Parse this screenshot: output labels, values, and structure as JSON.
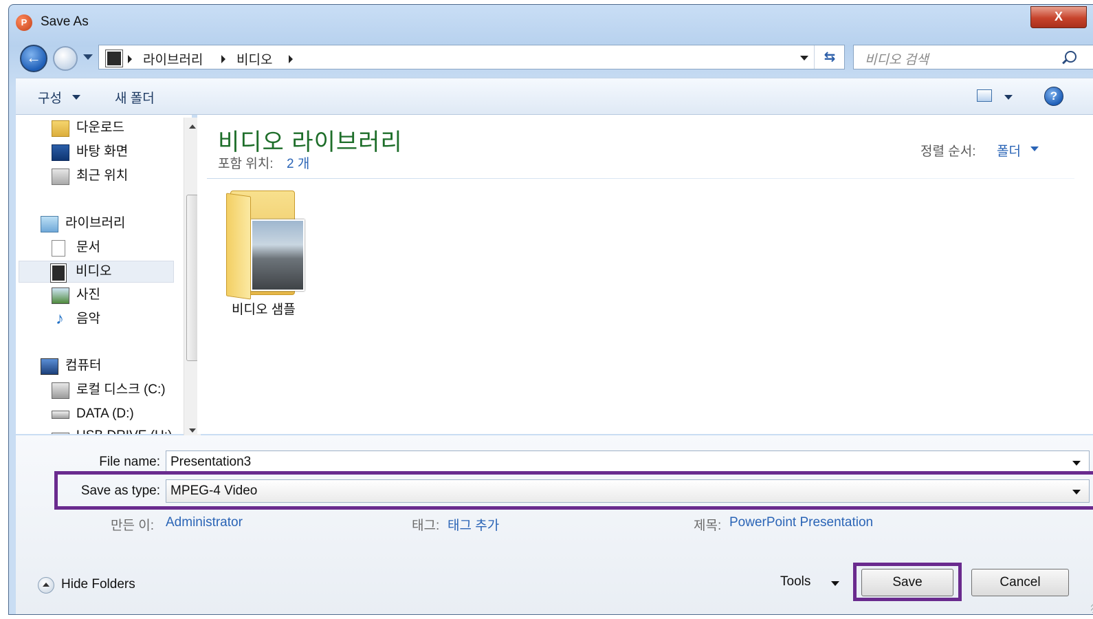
{
  "window": {
    "title": "Save As",
    "close_label": "X",
    "app_icon_letter": "P"
  },
  "navigation": {
    "breadcrumbs": [
      "라이브러리",
      "비디오"
    ],
    "search_placeholder": "비디오 검색"
  },
  "toolbar": {
    "organize_label": "구성",
    "new_folder_label": "새 폴더"
  },
  "sidebar": {
    "items": [
      {
        "label": "다운로드",
        "icon": "download-folder-icon"
      },
      {
        "label": "바탕 화면",
        "icon": "desktop-icon"
      },
      {
        "label": "최근 위치",
        "icon": "recent-places-icon"
      },
      {
        "label": "라이브러리",
        "icon": "library-icon"
      },
      {
        "label": "문서",
        "icon": "documents-icon"
      },
      {
        "label": "비디오",
        "icon": "video-icon",
        "selected": true
      },
      {
        "label": "사진",
        "icon": "pictures-icon"
      },
      {
        "label": "음악",
        "icon": "music-icon"
      },
      {
        "label": "컴퓨터",
        "icon": "computer-icon"
      },
      {
        "label": "로컬 디스크 (C:)",
        "icon": "local-disk-icon"
      },
      {
        "label": "DATA (D:)",
        "icon": "drive-icon"
      },
      {
        "label": "USB DRIVE (H:)",
        "icon": "usb-drive-icon"
      }
    ]
  },
  "main": {
    "library_title": "비디오 라이브러리",
    "includes_label": "포함 위치:",
    "includes_value": "2 개",
    "sort_label": "정렬 순서:",
    "sort_value": "폴더",
    "items": [
      {
        "label": "비디오 샘플",
        "icon": "folder-icon"
      }
    ]
  },
  "form": {
    "file_name_label": "File name:",
    "file_name_value": "Presentation3",
    "save_type_label": "Save as type:",
    "save_type_value": "MPEG-4 Video",
    "author_label": "만든 이:",
    "author_value": "Administrator",
    "tags_label": "태그:",
    "tags_value": "태그 추가",
    "title_label": "제목:",
    "title_value": "PowerPoint Presentation"
  },
  "footer": {
    "hide_folders_label": "Hide Folders",
    "tools_label": "Tools",
    "save_label": "Save",
    "cancel_label": "Cancel"
  },
  "colors": {
    "highlight": "#6a2b8e",
    "link": "#2a64b6",
    "library_title": "#1e6e2a"
  }
}
